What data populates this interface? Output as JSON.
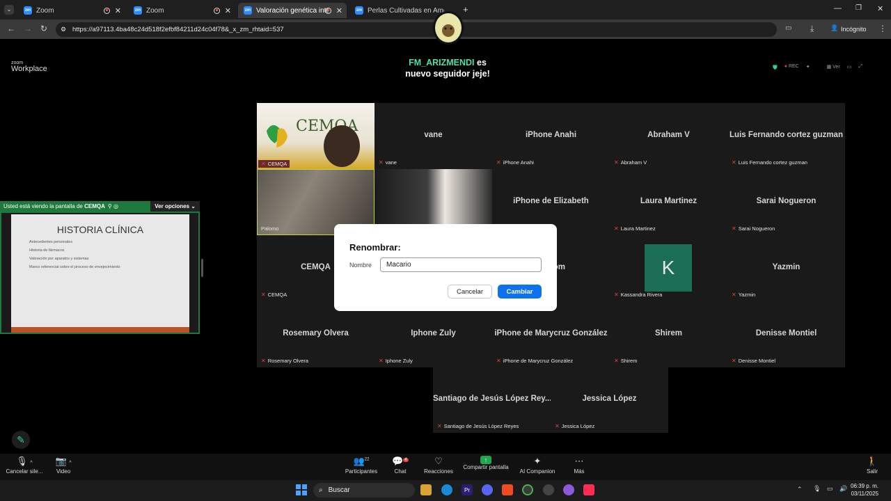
{
  "browser": {
    "tabs": [
      {
        "label": "Zoom",
        "favicon": "zm"
      },
      {
        "label": "Zoom",
        "favicon": "zm"
      },
      {
        "label": "Valoración genética integra",
        "favicon": "zm"
      },
      {
        "label": "Perlas Cultivadas en Amor",
        "favicon": "zm"
      }
    ],
    "url": "https://a97113.4ba48c24d518f2efbf84211d24c04f78&_x_zm_rhtaid=537",
    "incognito_label": "Incógnito"
  },
  "zoom": {
    "logo_top": "zoom",
    "logo_bottom": "Workplace",
    "follow_nick": "FM_ARIZMENDI",
    "follow_suffix": "es",
    "follow_line2": "nuevo seguidor jeje!",
    "rec_label": "REC",
    "view_label": "Ver"
  },
  "share": {
    "banner_text": "Usted está viendo la pantalla de",
    "presenter": "CEMQA",
    "options_label": "Ver opciones",
    "slide_title": "HISTORIA CLÍNICA",
    "slide_items": [
      "Antecedentes personales",
      "Historia de fármacos",
      "Valoración por aparatos y sistemas",
      "Marco referencial sobre el proceso de envejecimiento"
    ]
  },
  "participants": [
    {
      "name": "CEMQA",
      "label": "CEMQA",
      "video": true
    },
    {
      "name": "vane",
      "label": "vane"
    },
    {
      "name": "iPhone Anahi",
      "label": "iPhone Anahi"
    },
    {
      "name": "Abraham V",
      "label": "Abraham V"
    },
    {
      "name": "Luis Fernando cortez guzman",
      "label": "Luis Fernando cortez guzman"
    },
    {
      "name": "Palomo",
      "label": "Palomo",
      "video": true
    },
    {
      "name": "",
      "label": "",
      "video": true
    },
    {
      "name": "iPhone de Elizabeth",
      "label": ""
    },
    {
      "name": "Laura Martinez",
      "label": "Laura Martinez"
    },
    {
      "name": "Sarai Nogueron",
      "label": "Sarai Nogueron"
    },
    {
      "name": "CEMQA",
      "label": "CEMQA"
    },
    {
      "name": "",
      "label": ""
    },
    {
      "name": "e Zoom",
      "label": ""
    },
    {
      "name": "K",
      "label": "Kassandra Rivera"
    },
    {
      "name": "Yazmin",
      "label": "Yazmin"
    },
    {
      "name": "Rosemary Olvera",
      "label": "Rosemary Olvera"
    },
    {
      "name": "Iphone Zuly",
      "label": "Iphone Zuly"
    },
    {
      "name": "iPhone de Marycruz González",
      "label": "iPhone de Marycruz González"
    },
    {
      "name": "Shirem",
      "label": "Shirem"
    },
    {
      "name": "Denisse Montiel",
      "label": "Denisse Montiel"
    },
    {
      "name": "Santiago de Jesús López Rey...",
      "label": "Santiago de Jesús López Reyes"
    },
    {
      "name": "Jessica López",
      "label": "Jessica López"
    }
  ],
  "dialog": {
    "title": "Renombrar:",
    "field_label": "Nombre",
    "field_value": "Macario",
    "cancel_label": "Cancelar",
    "confirm_label": "Cambiar"
  },
  "toolbar": {
    "mic_label": "Cancelar sile...",
    "video_label": "Video",
    "participants_label": "Participantes",
    "participants_count": "22",
    "chat_label": "Chat",
    "chat_badge": "4",
    "reactions_label": "Reacciones",
    "share_label": "Compartir pantalla",
    "ai_label": "AI Companion",
    "more_label": "Más",
    "leave_label": "Salir"
  },
  "taskbar": {
    "search_label": "Buscar",
    "time": "06:39 p. m.",
    "date": "03/11/2025"
  },
  "colors": {
    "accent": "#0e72ed",
    "share_green": "#1d7a3c",
    "follow_nick": "#4ee0a6",
    "muted_mic": "#e04444",
    "avatar_k": "#1b6e55"
  }
}
